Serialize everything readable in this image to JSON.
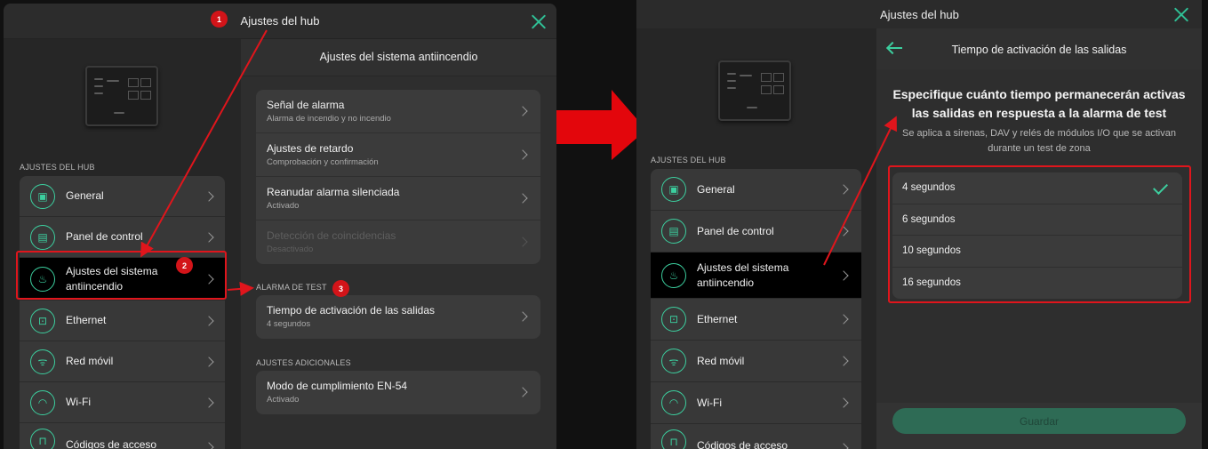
{
  "left": {
    "window_title": "Ajustes del hub",
    "sidebar_section": "AJUSTES DEL HUB",
    "sidebar_items": [
      {
        "label": "General",
        "icon": "hub-icon"
      },
      {
        "label": "Panel de control",
        "icon": "control-panel-icon"
      },
      {
        "label": "Ajustes del sistema antiincendio",
        "icon": "fire-icon"
      },
      {
        "label": "Ethernet",
        "icon": "ethernet-icon"
      },
      {
        "label": "Red móvil",
        "icon": "antenna-icon"
      },
      {
        "label": "Wi-Fi",
        "icon": "wifi-icon"
      },
      {
        "label": "Códigos de acceso",
        "icon": "lock-icon"
      }
    ],
    "panel_title": "Ajustes del sistema antiincendio",
    "fire_rows": [
      {
        "title": "Señal de alarma",
        "sub": "Alarma de incendio y no incendio"
      },
      {
        "title": "Ajustes de retardo",
        "sub": "Comprobación y confirmación"
      },
      {
        "title": "Reanudar alarma silenciada",
        "sub": "Activado"
      },
      {
        "title": "Detección de coincidencias",
        "sub": "Desactivado"
      }
    ],
    "test_section": "ALARMA DE TEST",
    "test_row": {
      "title": "Tiempo de activación de las salidas",
      "sub": "4 segundos"
    },
    "extra_section": "AJUSTES ADICIONALES",
    "extra_row": {
      "title": "Modo de cumplimiento EN-54",
      "sub": "Activado"
    }
  },
  "right": {
    "window_title": "Ajustes del hub",
    "sidebar_section": "AJUSTES DEL HUB",
    "sidebar_items": [
      {
        "label": "General",
        "icon": "hub-icon"
      },
      {
        "label": "Panel de control",
        "icon": "control-panel-icon"
      },
      {
        "label": "Ajustes del sistema antiincendio",
        "icon": "fire-icon"
      },
      {
        "label": "Ethernet",
        "icon": "ethernet-icon"
      },
      {
        "label": "Red móvil",
        "icon": "antenna-icon"
      },
      {
        "label": "Wi-Fi",
        "icon": "wifi-icon"
      },
      {
        "label": "Códigos de acceso",
        "icon": "lock-icon"
      }
    ],
    "panel_title": "Tiempo de activación de las salidas",
    "question": "Especifique cuánto tiempo permanecerán activas las salidas en respuesta a la alarma de test",
    "hint": "Se aplica a sirenas, DAV y relés de módulos I/O que se activan durante un test de zona",
    "options": [
      "4 segundos",
      "6 segundos",
      "10 segundos",
      "16 segundos"
    ],
    "selected_option": "4 segundos",
    "save_label": "Guardar"
  },
  "annotations": {
    "badge_1": "1",
    "badge_2": "2",
    "badge_3": "3",
    "color": "#e0151c"
  },
  "colors": {
    "accent": "#3ccf9f",
    "highlight": "#e0151c"
  }
}
